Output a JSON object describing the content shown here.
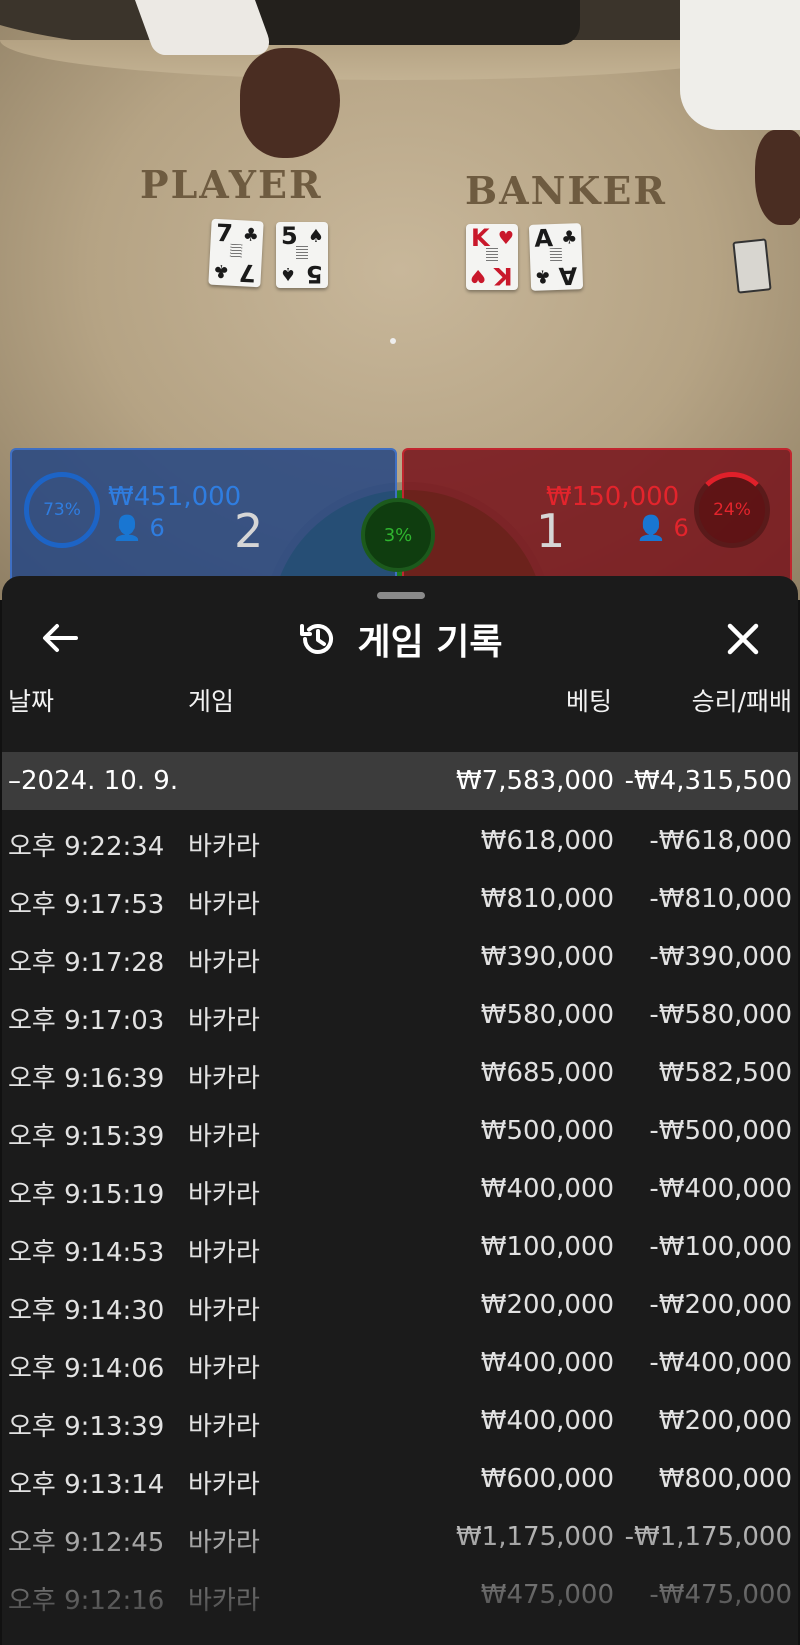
{
  "table": {
    "player_label": "PLAYER",
    "banker_label": "BANKER",
    "player_cards": [
      {
        "rank": "7",
        "suit": "♣",
        "color": "black"
      },
      {
        "rank": "5",
        "suit": "♠",
        "color": "black"
      }
    ],
    "banker_cards": [
      {
        "rank": "K",
        "suit": "♥",
        "color": "red"
      },
      {
        "rank": "A",
        "suit": "♣",
        "color": "black"
      }
    ]
  },
  "bets": {
    "player": {
      "percent": "73%",
      "amount": "₩451,000",
      "count": "6",
      "score": "2"
    },
    "tie": {
      "percent": "3%"
    },
    "banker": {
      "percent": "24%",
      "amount": "₩150,000",
      "count": "6",
      "score": "1"
    }
  },
  "sheet": {
    "title": "게임 기록",
    "columns": {
      "date": "날짜",
      "game": "게임",
      "bet": "베팅",
      "win_loss": "승리/패배"
    },
    "day": {
      "date": "–2024. 10. 9.",
      "bet": "₩7,583,000",
      "win_loss": "-₩4,315,500"
    },
    "rows": [
      {
        "time": "오후 9:22:34",
        "game": "바카라",
        "bet": "₩618,000",
        "win_loss": "-₩618,000"
      },
      {
        "time": "오후 9:17:53",
        "game": "바카라",
        "bet": "₩810,000",
        "win_loss": "-₩810,000"
      },
      {
        "time": "오후 9:17:28",
        "game": "바카라",
        "bet": "₩390,000",
        "win_loss": "-₩390,000"
      },
      {
        "time": "오후 9:17:03",
        "game": "바카라",
        "bet": "₩580,000",
        "win_loss": "-₩580,000"
      },
      {
        "time": "오후 9:16:39",
        "game": "바카라",
        "bet": "₩685,000",
        "win_loss": "₩582,500"
      },
      {
        "time": "오후 9:15:39",
        "game": "바카라",
        "bet": "₩500,000",
        "win_loss": "-₩500,000"
      },
      {
        "time": "오후 9:15:19",
        "game": "바카라",
        "bet": "₩400,000",
        "win_loss": "-₩400,000"
      },
      {
        "time": "오후 9:14:53",
        "game": "바카라",
        "bet": "₩100,000",
        "win_loss": "-₩100,000"
      },
      {
        "time": "오후 9:14:30",
        "game": "바카라",
        "bet": "₩200,000",
        "win_loss": "-₩200,000"
      },
      {
        "time": "오후 9:14:06",
        "game": "바카라",
        "bet": "₩400,000",
        "win_loss": "-₩400,000"
      },
      {
        "time": "오후 9:13:39",
        "game": "바카라",
        "bet": "₩400,000",
        "win_loss": "₩200,000"
      },
      {
        "time": "오후 9:13:14",
        "game": "바카라",
        "bet": "₩600,000",
        "win_loss": "₩800,000"
      },
      {
        "time": "오후 9:12:45",
        "game": "바카라",
        "bet": "₩1,175,000",
        "win_loss": "-₩1,175,000"
      },
      {
        "time": "오후 9:12:16",
        "game": "바카라",
        "bet": "₩475,000",
        "win_loss": "-₩475,000"
      }
    ]
  },
  "colors": {
    "player": "#2f7de0",
    "banker": "#e3242c",
    "tie": "#2fb52f",
    "sheet_bg": "#1b1b1b",
    "day_row_bg": "#3c3c3c"
  },
  "icons": {
    "back": "arrow-left-icon",
    "history": "history-icon",
    "close": "close-icon",
    "person": "person-icon"
  }
}
